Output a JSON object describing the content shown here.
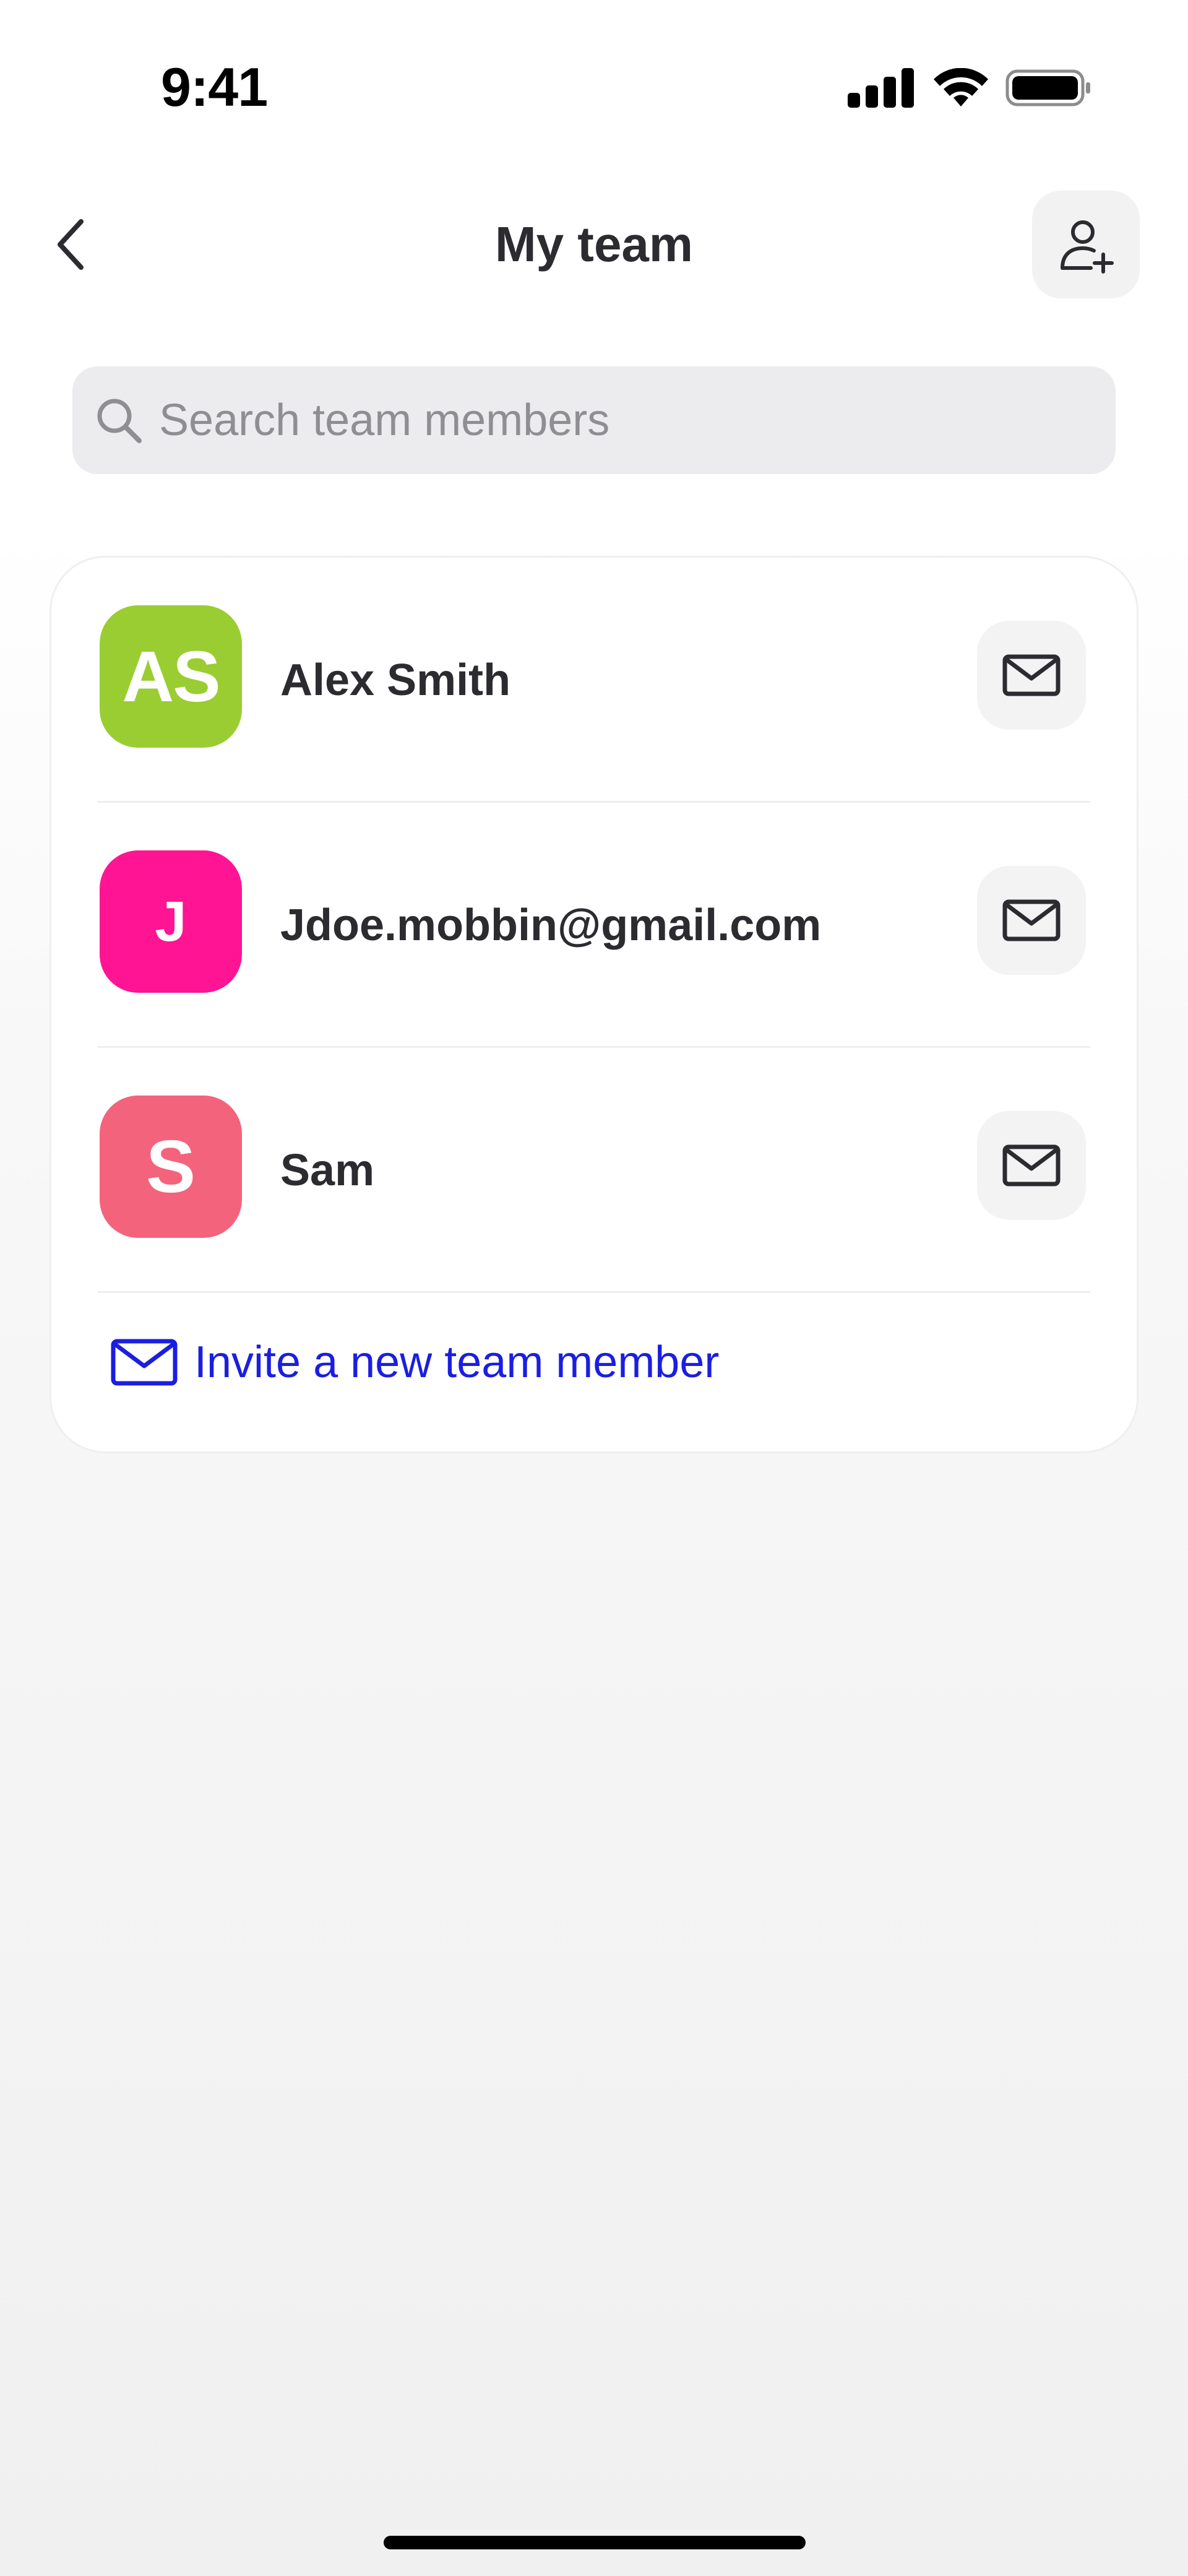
{
  "status_bar": {
    "time": "9:41",
    "icons": [
      "signal-icon",
      "wifi-icon",
      "battery-icon"
    ]
  },
  "header": {
    "title": "My team",
    "back_icon": "chevron-left-icon",
    "add_icon": "user-plus-icon"
  },
  "search": {
    "placeholder": "Search team members",
    "value": "",
    "icon": "search-icon"
  },
  "members": [
    {
      "initials": "AS",
      "name": "Alex Smith",
      "avatar_color": "#9ACD32"
    },
    {
      "initials": "J",
      "name": "Jdoe.mobbin@gmail.com",
      "avatar_color": "#FF1493"
    },
    {
      "initials": "S",
      "name": "Sam",
      "avatar_color": "#F4637C"
    }
  ],
  "invite": {
    "label": "Invite a new team member",
    "color": "#1B1EE0",
    "icon": "mail-icon"
  },
  "colors": {
    "text_primary": "#2B2B30",
    "accent": "#1B1EE0"
  }
}
